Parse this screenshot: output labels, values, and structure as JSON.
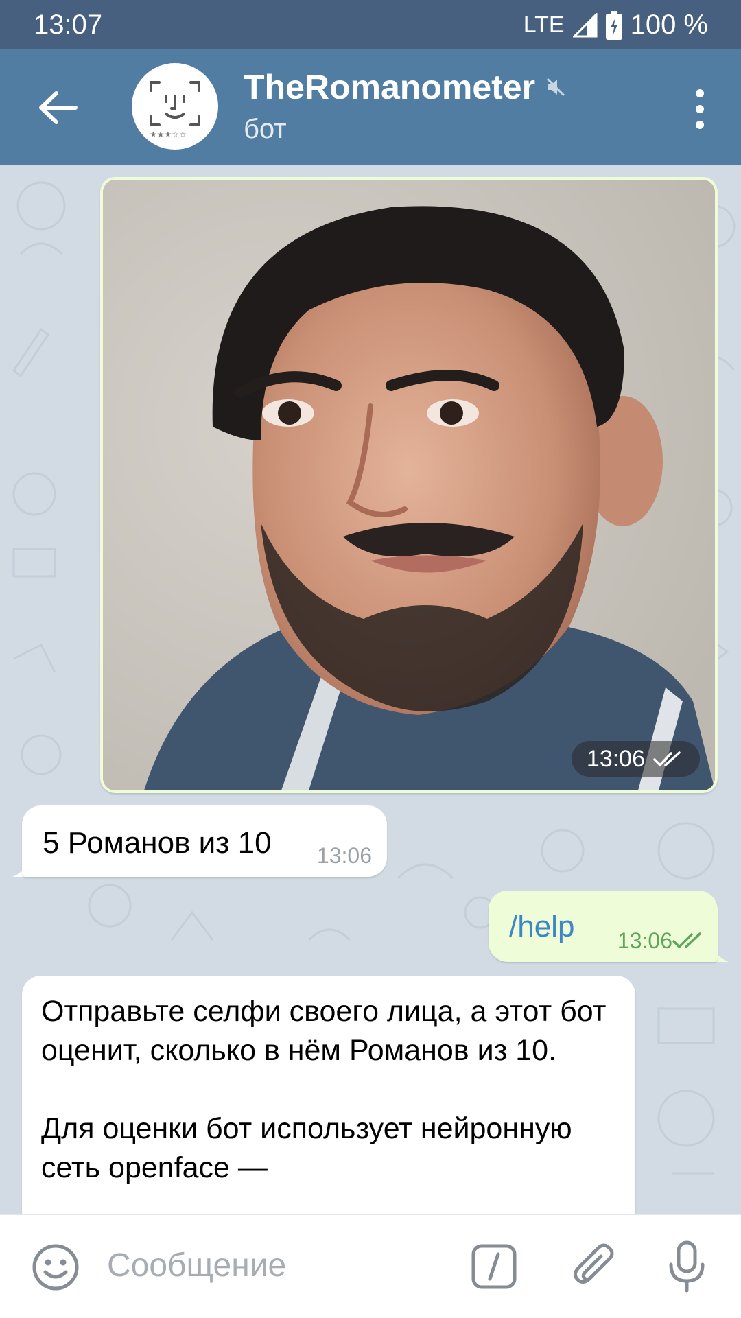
{
  "status_bar": {
    "time": "13:07",
    "network": "LTE",
    "battery": "100 %"
  },
  "header": {
    "title": "TheRomanometer",
    "subtitle": "бот",
    "icons": [
      "back-arrow-icon",
      "bot-avatar-face-icon",
      "muted-speaker-icon",
      "more-vert-icon"
    ]
  },
  "messages": [
    {
      "type": "photo",
      "direction": "out",
      "time": "13:06",
      "status": "read"
    },
    {
      "type": "text",
      "direction": "in",
      "text": "5 Романов из 10",
      "time": "13:06"
    },
    {
      "type": "text",
      "direction": "out",
      "text": "/help",
      "time": "13:06",
      "status": "read"
    },
    {
      "type": "text",
      "direction": "in",
      "text": "Отправьте селфи своего лица, а этот бот оценит, сколько в нём Романов из 10.\n\nДля оценки бот использует нейронную сеть openface —"
    }
  ],
  "input": {
    "placeholder": "Сообщение",
    "icons": [
      "emoji-icon",
      "bot-command-icon",
      "attach-icon",
      "microphone-icon"
    ]
  },
  "colors": {
    "status_bar": "#476080",
    "app_bar": "#517da2",
    "chat_bg": "#d2dbe4",
    "outgoing_bubble": "#eefcd8",
    "incoming_bubble": "#ffffff",
    "link_blue": "#3f86c6",
    "read_green": "#5fa55a"
  }
}
